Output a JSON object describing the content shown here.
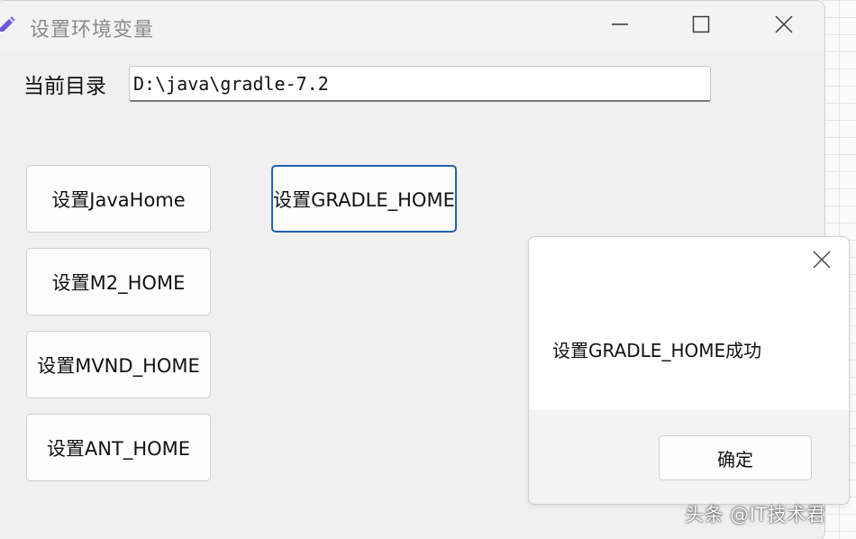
{
  "window": {
    "title": "设置环境变量",
    "minimize_icon": "minimize-icon",
    "maximize_icon": "maximize-icon",
    "close_icon": "close-icon"
  },
  "form": {
    "current_dir_label": "当前目录",
    "current_dir_value": "D:\\java\\gradle-7.2"
  },
  "buttons": {
    "java_home": "设置JavaHome",
    "gradle_home": "设置GRADLE_HOME",
    "m2_home": "设置M2_HOME",
    "mvnd_home": "设置MVND_HOME",
    "ant_home": "设置ANT_HOME"
  },
  "dialog": {
    "message": "设置GRADLE_HOME成功",
    "ok_label": "确定",
    "close_icon": "close-icon"
  },
  "watermark": "头条 @IT技术君",
  "colors": {
    "focus_border": "#1f62b0",
    "app_icon": "#6b5bd6"
  }
}
